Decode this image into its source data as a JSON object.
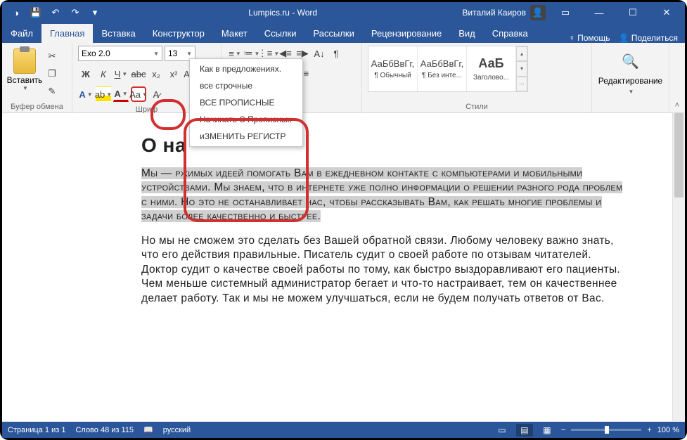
{
  "titlebar": {
    "title": "Lumpics.ru - Word",
    "user": "Виталий Каиров"
  },
  "tabs": {
    "file": "Файл",
    "home": "Главная",
    "insert": "Вставка",
    "design": "Конструктор",
    "layout": "Макет",
    "references": "Ссылки",
    "mailings": "Рассылки",
    "review": "Рецензирование",
    "view": "Вид",
    "help": "Справка",
    "tell_me": "Помощь",
    "share": "Поделиться"
  },
  "ribbon": {
    "clipboard": {
      "label": "Буфер обмена",
      "paste": "Вставить"
    },
    "font": {
      "label": "Шриф",
      "name": "Exo 2.0",
      "size": "13"
    },
    "paragraph": {
      "label": "а"
    },
    "styles": {
      "label": "Стили",
      "items": [
        {
          "preview": "АаБбВвГг,",
          "name": "¶ Обычный"
        },
        {
          "preview": "АаБбВвГг,",
          "name": "¶ Без инте..."
        },
        {
          "preview": "АаБ",
          "name": "Заголово..."
        }
      ]
    },
    "editing": {
      "label": "Редактирование"
    }
  },
  "case_menu": {
    "sentence": "Как в предложениях.",
    "lower": "все строчные",
    "upper": "ВСЕ ПРОПИСНЫЕ",
    "capitalize": "Начинать С Прописных",
    "toggle": "иЗМЕНИТЬ РЕГИСТР"
  },
  "document": {
    "heading": "О на",
    "p1": "Мы —                                                    ржимых идеей помогать Вам в ежедневном контакте с компьютерами и мобильными устройствами. Мы знаем, что в интернете уже полно информации о решении разного рода проблем с ними. Но это не останавливает нас, чтобы рассказывать Вам, как решать многие проблемы и задачи более качественно и быстрее.",
    "p2": "Но мы не сможем это сделать без Вашей обратной связи. Любому человеку важно знать, что его действия правильные. Писатель судит о своей работе по отзывам читателей. Доктор судит о качестве своей работы по тому, как быстро выздоравливают его пациенты. Чем меньше системный администратор бегает и что-то настраивает, тем он качественнее делает работу. Так и мы не можем улучшаться, если не будем получать ответов от Вас."
  },
  "statusbar": {
    "page": "Страница 1 из 1",
    "words": "Слово 48 из 115",
    "lang": "русский",
    "zoom": "100 %"
  }
}
